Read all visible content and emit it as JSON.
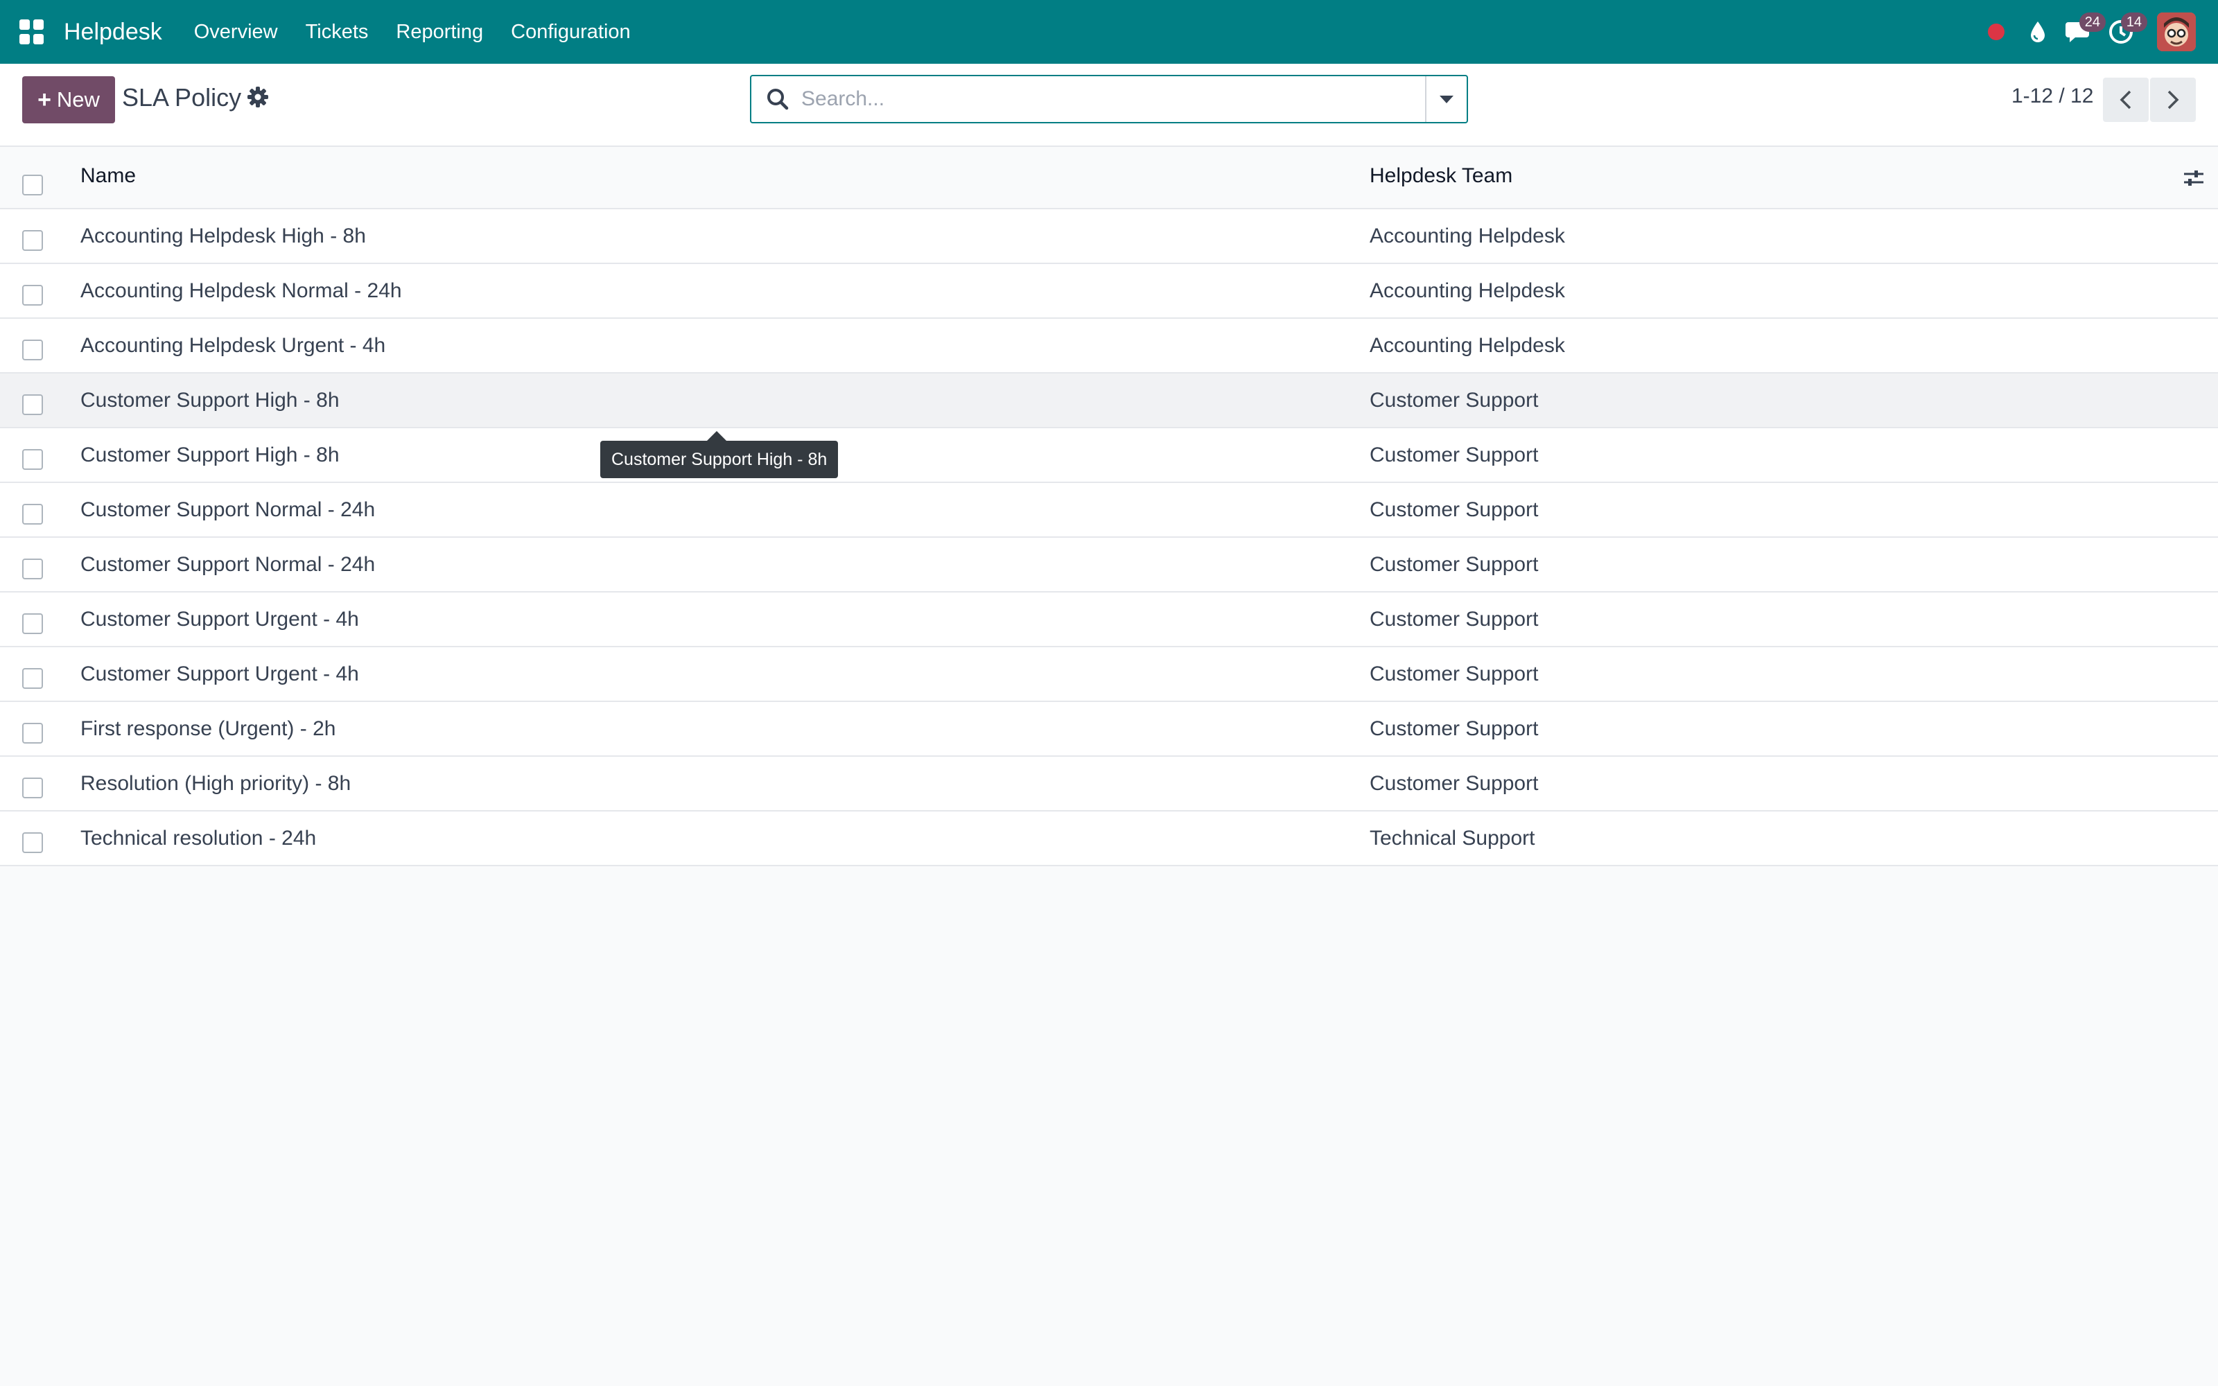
{
  "navbar": {
    "brand": "Helpdesk",
    "menu": [
      "Overview",
      "Tickets",
      "Reporting",
      "Configuration"
    ],
    "messages_badge": "24",
    "activities_badge": "14",
    "colors": {
      "bar": "#017e84",
      "badge": "#714b67",
      "status_dot": "#dc3545"
    }
  },
  "control_panel": {
    "new_label": "New",
    "title": "SLA Policy",
    "search_placeholder": "Search...",
    "pager_value": "1-12 / 12"
  },
  "list": {
    "columns": {
      "name": "Name",
      "team": "Helpdesk Team"
    },
    "rows": [
      {
        "name": "Accounting Helpdesk High - 8h",
        "team": "Accounting Helpdesk"
      },
      {
        "name": "Accounting Helpdesk Normal - 24h",
        "team": "Accounting Helpdesk"
      },
      {
        "name": "Accounting Helpdesk Urgent - 4h",
        "team": "Accounting Helpdesk"
      },
      {
        "name": "Customer Support High - 8h",
        "team": "Customer Support"
      },
      {
        "name": "Customer Support High - 8h",
        "team": "Customer Support"
      },
      {
        "name": "Customer Support Normal - 24h",
        "team": "Customer Support"
      },
      {
        "name": "Customer Support Normal - 24h",
        "team": "Customer Support"
      },
      {
        "name": "Customer Support Urgent - 4h",
        "team": "Customer Support"
      },
      {
        "name": "Customer Support Urgent - 4h",
        "team": "Customer Support"
      },
      {
        "name": "First response (Urgent) - 2h",
        "team": "Customer Support"
      },
      {
        "name": "Resolution (High priority) - 8h",
        "team": "Customer Support"
      },
      {
        "name": "Technical resolution - 24h",
        "team": "Technical Support"
      }
    ]
  },
  "tooltip": {
    "text": "Customer Support High - 8h"
  }
}
